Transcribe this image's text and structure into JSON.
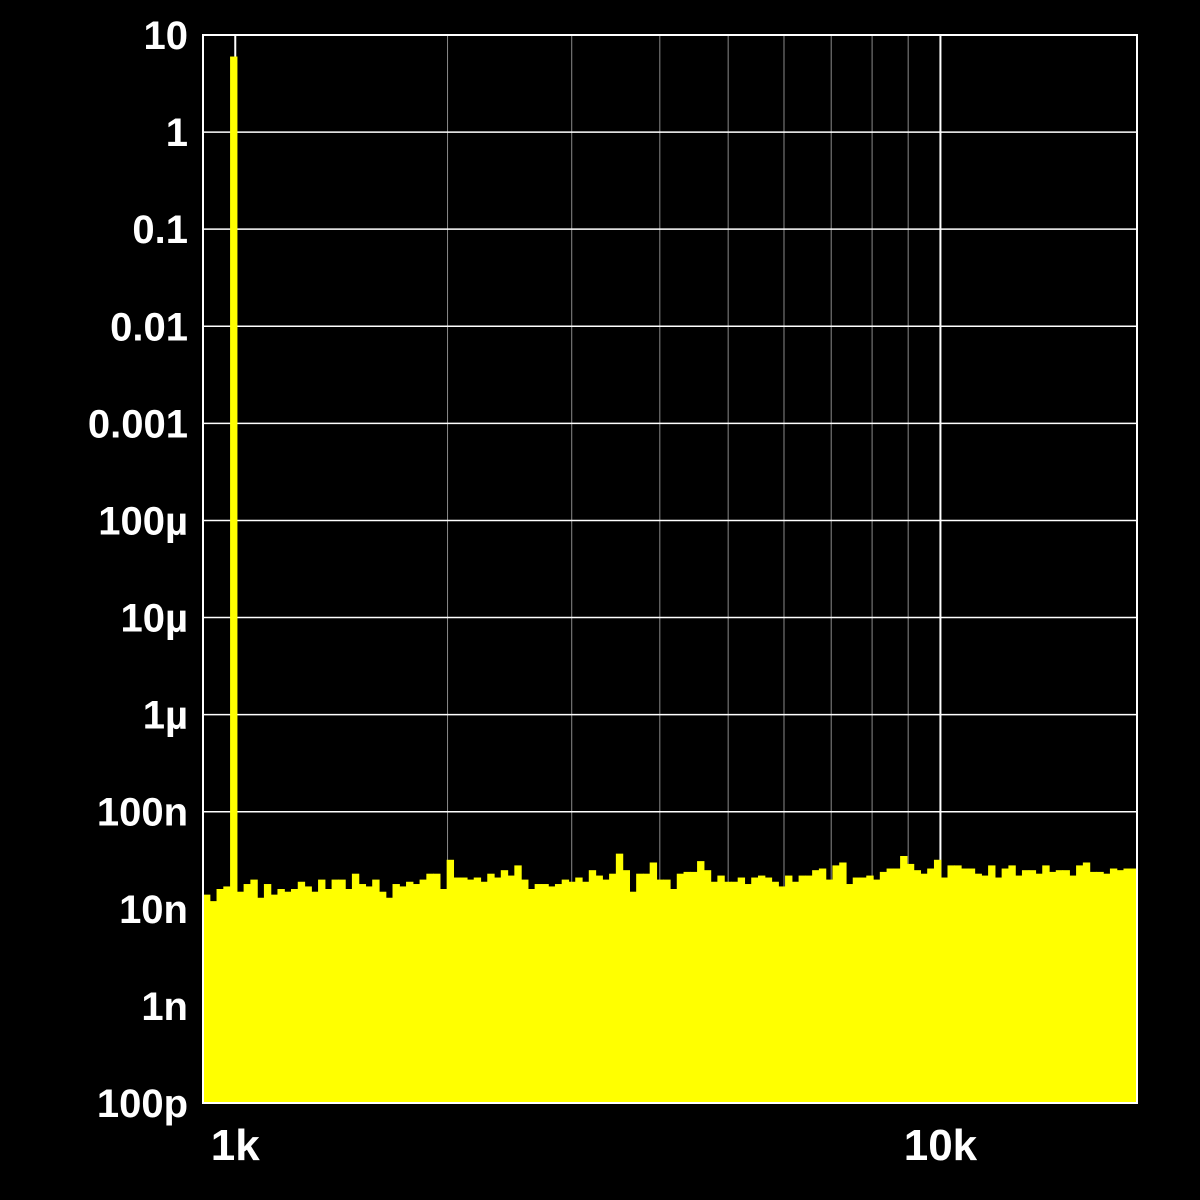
{
  "chart_data": {
    "type": "bar",
    "title": "",
    "xlabel": "",
    "ylabel": "",
    "x_scale": "log",
    "y_scale": "log",
    "xlim": [
      900,
      19000
    ],
    "ylim": [
      1e-10,
      10
    ],
    "grid": true,
    "colors": {
      "background": "#000000",
      "series": "#ffff00",
      "grid_minor": "#8a8a8a",
      "grid_major": "#ffffff",
      "text": "#ffffff"
    },
    "x_ticks": [
      {
        "value": 1000,
        "label": "1k"
      },
      {
        "value": 10000,
        "label": "10k"
      }
    ],
    "x_minor_gridlines": [
      2000,
      3000,
      4000,
      5000,
      6000,
      7000,
      8000,
      9000
    ],
    "y_ticks": [
      {
        "value": 10,
        "label": "10"
      },
      {
        "value": 1,
        "label": "1"
      },
      {
        "value": 0.1,
        "label": "0.1"
      },
      {
        "value": 0.01,
        "label": "0.01"
      },
      {
        "value": 0.001,
        "label": "0.001"
      },
      {
        "value": 0.0001,
        "label": "100µ"
      },
      {
        "value": 1e-05,
        "label": "10µ"
      },
      {
        "value": 1e-06,
        "label": "1µ"
      },
      {
        "value": 1e-07,
        "label": "100n"
      },
      {
        "value": 1e-08,
        "label": "10n"
      },
      {
        "value": 1e-09,
        "label": "1n"
      },
      {
        "value": 1e-10,
        "label": "100p"
      }
    ],
    "series": [
      {
        "x_start": 900,
        "x_end": 19000,
        "values": [
          1.4e-08,
          1.2e-08,
          1.6e-08,
          1.7e-08,
          6.0,
          1.5e-08,
          1.8e-08,
          2e-08,
          1.3e-08,
          1.8e-08,
          1.4e-08,
          1.6e-08,
          1.5e-08,
          1.6e-08,
          1.9e-08,
          1.7e-08,
          1.5e-08,
          2e-08,
          1.6e-08,
          2e-08,
          2e-08,
          1.6e-08,
          2.3e-08,
          1.8e-08,
          1.7e-08,
          2e-08,
          1.5e-08,
          1.3e-08,
          1.8e-08,
          1.7e-08,
          1.9e-08,
          1.8e-08,
          2e-08,
          2.3e-08,
          2.3e-08,
          1.6e-08,
          3.2e-08,
          2.1e-08,
          2.1e-08,
          2e-08,
          2.1e-08,
          1.9e-08,
          2.3e-08,
          2.1e-08,
          2.5e-08,
          2.2e-08,
          2.8e-08,
          2e-08,
          1.6e-08,
          1.8e-08,
          1.8e-08,
          1.7e-08,
          1.8e-08,
          2e-08,
          1.9e-08,
          2.1e-08,
          1.9e-08,
          2.5e-08,
          2.2e-08,
          2e-08,
          2.3e-08,
          3.7e-08,
          2.5e-08,
          1.5e-08,
          2.3e-08,
          2.3e-08,
          3e-08,
          2e-08,
          2e-08,
          1.6e-08,
          2.3e-08,
          2.4e-08,
          2.4e-08,
          3.1e-08,
          2.5e-08,
          1.9e-08,
          2.2e-08,
          1.9e-08,
          1.9e-08,
          2.1e-08,
          1.8e-08,
          2.1e-08,
          2.2e-08,
          2.1e-08,
          1.9e-08,
          1.7e-08,
          2.2e-08,
          1.9e-08,
          2.2e-08,
          2.2e-08,
          2.5e-08,
          2.6e-08,
          2e-08,
          2.8e-08,
          3e-08,
          1.8e-08,
          2.1e-08,
          2.1e-08,
          2.2e-08,
          2e-08,
          2.4e-08,
          2.6e-08,
          2.6e-08,
          3.5e-08,
          2.9e-08,
          2.5e-08,
          2.3e-08,
          2.6e-08,
          3.2e-08,
          2.1e-08,
          2.8e-08,
          2.8e-08,
          2.6e-08,
          2.6e-08,
          2.3e-08,
          2.2e-08,
          2.8e-08,
          2.1e-08,
          2.6e-08,
          2.8e-08,
          2.2e-08,
          2.5e-08,
          2.5e-08,
          2.3e-08,
          2.8e-08,
          2.4e-08,
          2.5e-08,
          2.5e-08,
          2.2e-08,
          2.8e-08,
          3e-08,
          2.4e-08,
          2.4e-08,
          2.3e-08,
          2.6e-08,
          2.5e-08,
          2.6e-08,
          2.6e-08
        ]
      }
    ]
  }
}
